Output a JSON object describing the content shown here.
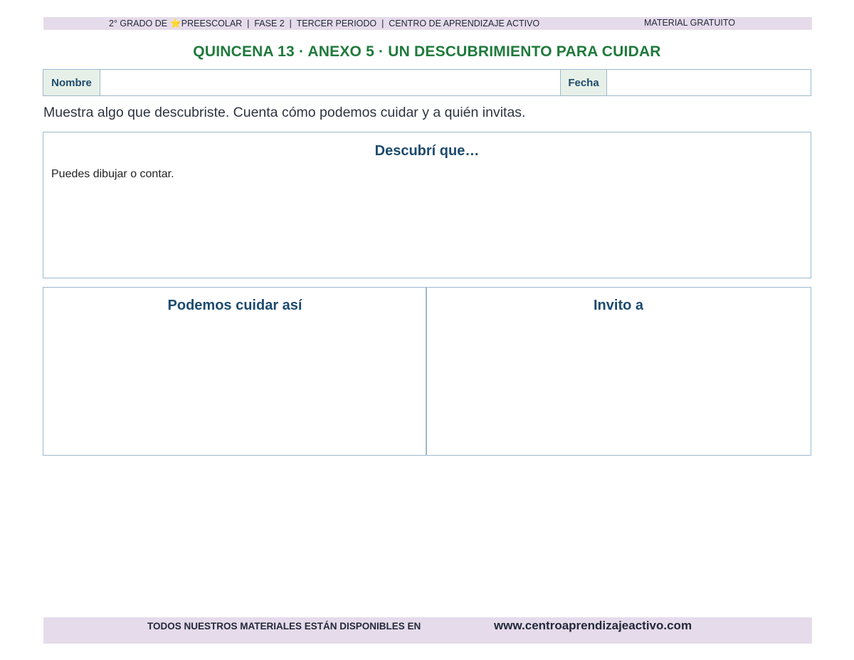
{
  "header": {
    "left_before_star": "2° GRADO DE ",
    "star_icon": "⭐",
    "left_after_star": "PREESCOLAR  |  FASE 2  |  TERCER PERIODO  |  CENTRO DE APRENDIZAJE ACTIVO",
    "right": "MATERIAL GRATUITO"
  },
  "title": "QUINCENA 13 · ANEXO 5 · UN DESCUBRIMIENTO PARA CUIDAR",
  "form": {
    "name_label": "Nombre",
    "name_value": "",
    "date_label": "Fecha",
    "date_value": ""
  },
  "instruction": "Muestra algo que descubriste. Cuenta cómo podemos cuidar y a quién invitas.",
  "discovery_box": {
    "title": "Descubrí que…",
    "hint": "Puedes dibujar o contar."
  },
  "care_box": {
    "title": "Podemos cuidar así"
  },
  "invite_box": {
    "title": "Invito a"
  },
  "footer": {
    "left": "TODOS NUESTROS MATERIALES ESTÁN DISPONIBLES EN",
    "url": "www.centroaprendizajeactivo.com"
  },
  "colors": {
    "band": "#e6dbeb",
    "title_green": "#1f7a3c",
    "heading_blue": "#1d4b6e",
    "border": "#9db8cc",
    "label_bg": "#e7f0e8"
  }
}
